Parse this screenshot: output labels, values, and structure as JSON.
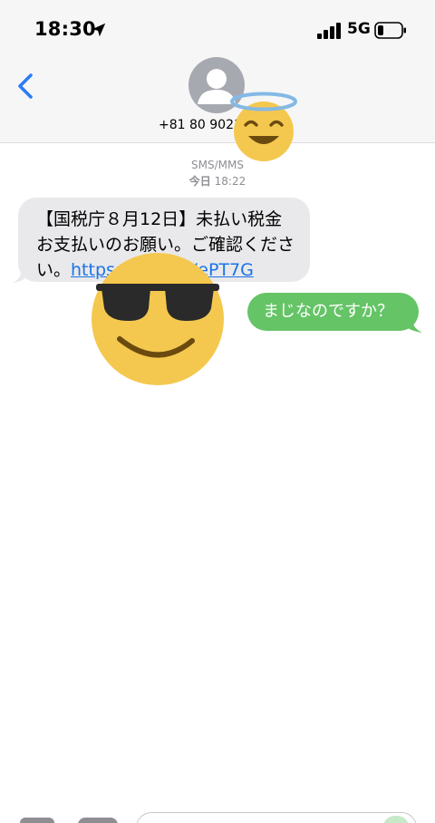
{
  "status_bar": {
    "time": "18:30",
    "network": "5G",
    "icons": [
      "location-arrow-icon",
      "signal-bars-icon",
      "battery-icon"
    ]
  },
  "header": {
    "contact_number": "+81 80 9021",
    "back_icon": "chevron-left-icon",
    "avatar_icon": "person-silhouette-icon"
  },
  "conversation": {
    "service": "SMS/MMS",
    "date_label": "今日",
    "time_label": "18:22",
    "incoming": {
      "text_before_link": "【国税庁８月12日】未払い税金お支払いのお願い。ご確認ください。",
      "link_start": "https://",
      "link_end": "XePT7G"
    },
    "outgoing": {
      "text": "まじなのですか？"
    }
  },
  "overlays": [
    "smiling-face-with-halo-emoji",
    "smiling-face-with-sunglasses-emoji"
  ],
  "colors": {
    "header_bg": "#f6f6f6",
    "incoming_bubble": "#e9e9eb",
    "outgoing_bubble": "#65c466",
    "link": "#1a73e8",
    "back_chevron": "#2c7cf6",
    "emoji_yellow": "#f4c84f",
    "halo_blue": "#84b9e6"
  }
}
